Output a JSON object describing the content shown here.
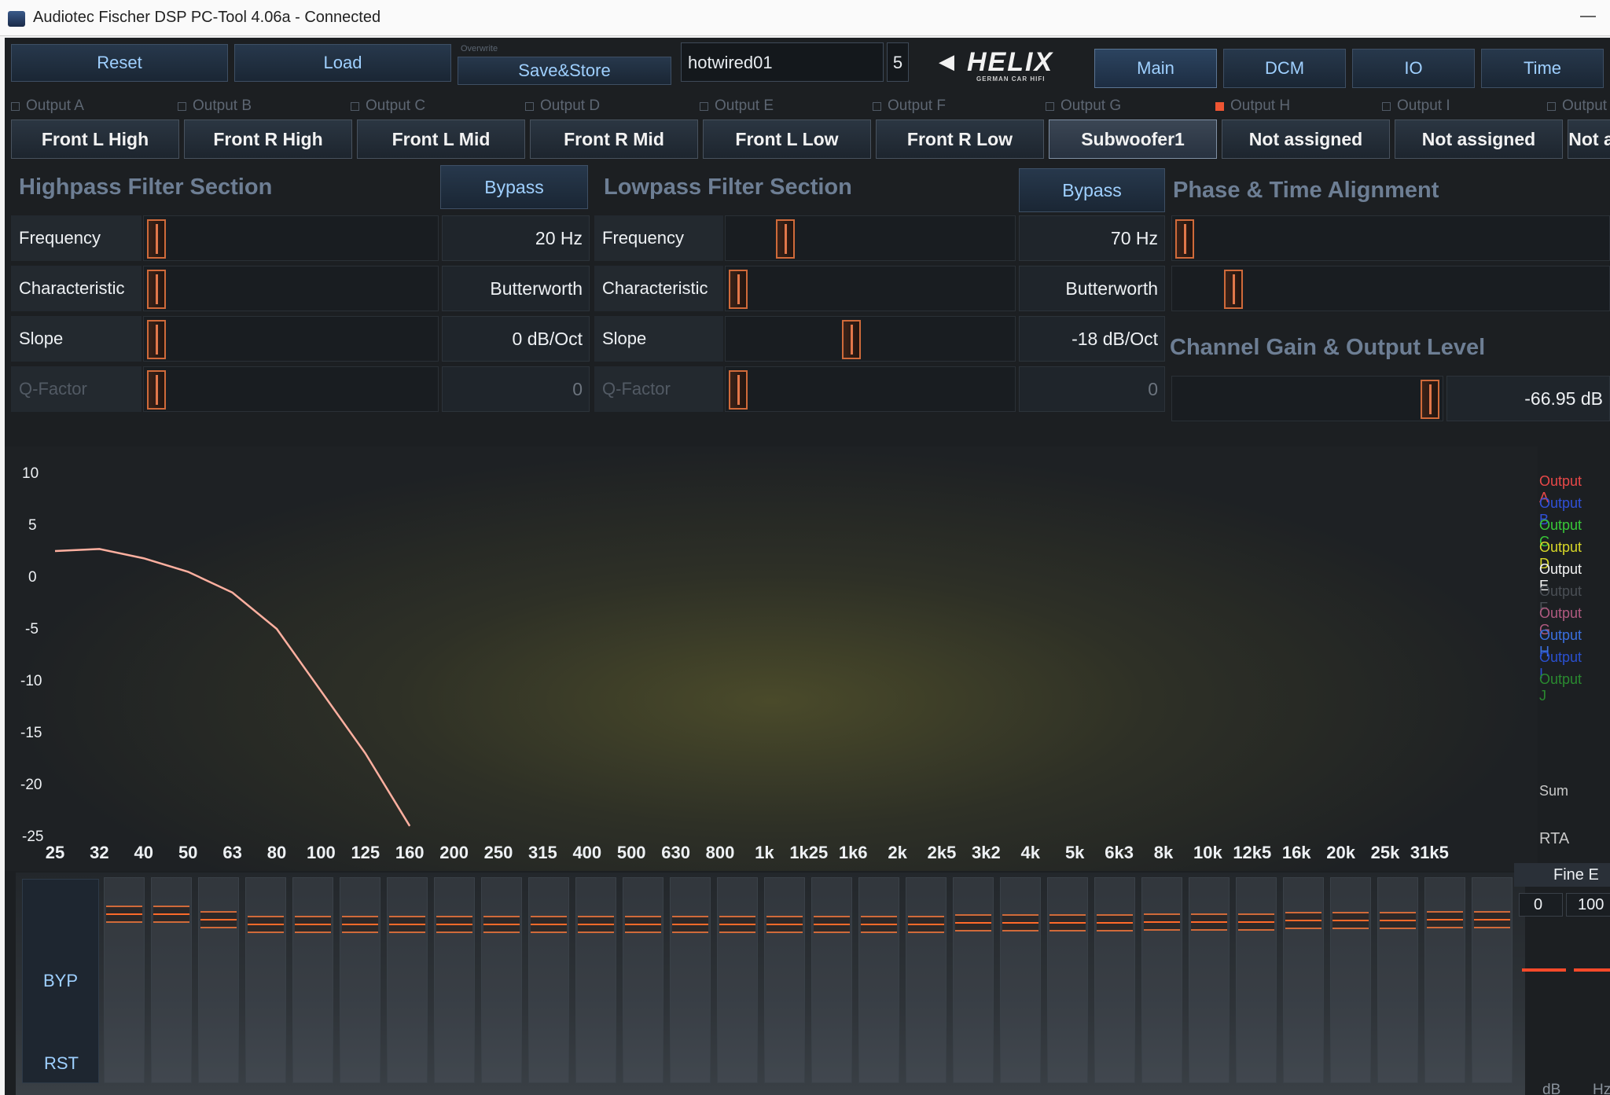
{
  "window": {
    "title": "Audiotec Fischer DSP PC-Tool 4.06a - Connected"
  },
  "toolbar": {
    "reset": "Reset",
    "load": "Load",
    "overwrite": "Overwrite",
    "save_store": "Save&Store",
    "preset_name": "hotwired01",
    "preset_number": "5",
    "logo_word": "HELIX",
    "logo_sub": "GERMAN CAR HIFI",
    "tabs": [
      "Main",
      "DCM",
      "IO",
      "Time"
    ]
  },
  "outputs": [
    {
      "label": "Output A",
      "channel": "Front L High"
    },
    {
      "label": "Output B",
      "channel": "Front R High"
    },
    {
      "label": "Output C",
      "channel": "Front L Mid"
    },
    {
      "label": "Output D",
      "channel": "Front R Mid"
    },
    {
      "label": "Output E",
      "channel": "Front L Low"
    },
    {
      "label": "Output F",
      "channel": "Front R Low"
    },
    {
      "label": "Output G",
      "channel": "Subwoofer1"
    },
    {
      "label": "Output H",
      "channel": "Not assigned"
    },
    {
      "label": "Output I",
      "channel": "Not assigned"
    },
    {
      "label": "Output",
      "channel": "Not a"
    }
  ],
  "highpass": {
    "title": "Highpass Filter Section",
    "bypass": "Bypass",
    "rows": [
      {
        "label": "Frequency",
        "value": "20 Hz"
      },
      {
        "label": "Characteristic",
        "value": "Butterworth"
      },
      {
        "label": "Slope",
        "value": "0 dB/Oct"
      },
      {
        "label": "Q-Factor",
        "value": "0"
      }
    ]
  },
  "lowpass": {
    "title": "Lowpass Filter Section",
    "bypass": "Bypass",
    "rows": [
      {
        "label": "Frequency",
        "value": "70 Hz"
      },
      {
        "label": "Characteristic",
        "value": "Butterworth"
      },
      {
        "label": "Slope",
        "value": "-18 dB/Oct"
      },
      {
        "label": "Q-Factor",
        "value": "0"
      }
    ]
  },
  "phase": {
    "title": "Phase & Time Alignment"
  },
  "gain": {
    "title": "Channel Gain & Output Level",
    "value": "-66.95 dB"
  },
  "graph": {
    "y_ticks": [
      "10",
      "5",
      "0",
      "-5",
      "-10",
      "-15",
      "-20",
      "-25"
    ],
    "x_ticks": [
      "25",
      "32",
      "40",
      "50",
      "63",
      "80",
      "100",
      "125",
      "160",
      "200",
      "250",
      "315",
      "400",
      "500",
      "630",
      "800",
      "1k",
      "1k25",
      "1k6",
      "2k",
      "2k5",
      "3k2",
      "4k",
      "5k",
      "6k3",
      "8k",
      "10k",
      "12k5",
      "16k",
      "20k",
      "25k",
      "31k5"
    ],
    "legend": [
      {
        "label": "Output A",
        "color": "#e84848"
      },
      {
        "label": "Output B",
        "color": "#3050d8"
      },
      {
        "label": "Output C",
        "color": "#38c838"
      },
      {
        "label": "Output D",
        "color": "#d8d828"
      },
      {
        "label": "Output E",
        "color": "#f4f4f4"
      },
      {
        "label": "Output F",
        "color": "#4a4f55"
      },
      {
        "label": "Output G",
        "color": "#b05a80"
      },
      {
        "label": "Output H",
        "color": "#3a70e0"
      },
      {
        "label": "Output I",
        "color": "#2a50d0"
      },
      {
        "label": "Output J",
        "color": "#2a8a30"
      }
    ],
    "sum": "Sum",
    "rta": "RTA",
    "response_color": "#ffb0a0",
    "response": [
      {
        "f": "25",
        "db": 2.5
      },
      {
        "f": "32",
        "db": 2.7
      },
      {
        "f": "40",
        "db": 1.8
      },
      {
        "f": "50",
        "db": 0.5
      },
      {
        "f": "63",
        "db": -1.5
      },
      {
        "f": "80",
        "db": -5
      },
      {
        "f": "100",
        "db": -11
      },
      {
        "f": "125",
        "db": -17
      },
      {
        "f": "160",
        "db": -24
      }
    ]
  },
  "eq": {
    "bypass": "BYP",
    "reset": "RST",
    "bands": [
      "25",
      "32",
      "40",
      "50",
      "63",
      "80",
      "100",
      "125",
      "160",
      "200",
      "250",
      "315",
      "400",
      "500",
      "630",
      "800",
      "1k",
      "1k2",
      "1k6",
      "2k",
      "2k5",
      "3k2",
      "4k",
      "5k",
      "6k3",
      "8k",
      "10k",
      "12k5",
      "16k",
      "20k"
    ],
    "fine_label": "Fine E",
    "fine_values": [
      "0",
      "100"
    ],
    "units": [
      "dB",
      "Hz"
    ]
  }
}
